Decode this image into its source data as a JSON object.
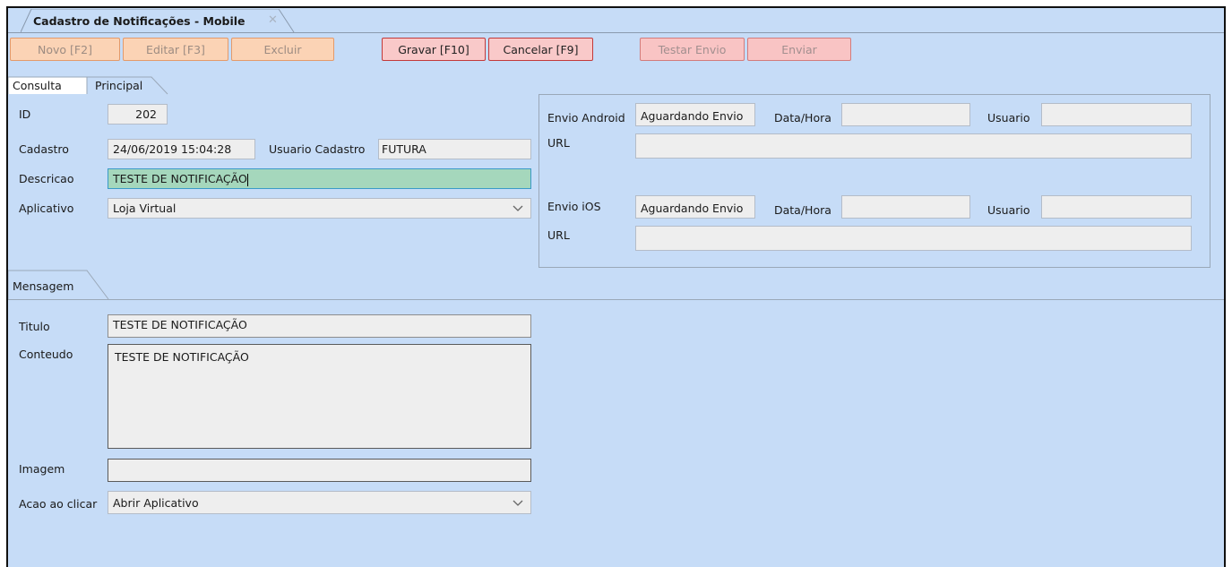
{
  "window": {
    "tab_title": "Cadastro de Notificações - Mobile",
    "close_glyph": "✕"
  },
  "toolbar": {
    "novo": "Novo [F2]",
    "editar": "Editar [F3]",
    "excluir": "Excluir",
    "gravar": "Gravar [F10]",
    "cancelar": "Cancelar [F9]",
    "testar_envio": "Testar Envio",
    "enviar": "Enviar"
  },
  "tabs": {
    "consulta": "Consulta",
    "principal": "Principal",
    "mensagem": "Mensagem"
  },
  "form": {
    "id_label": "ID",
    "id_value": "202",
    "cadastro_label": "Cadastro",
    "cadastro_value": "24/06/2019 15:04:28",
    "usuario_cadastro_label": "Usuario Cadastro",
    "usuario_cadastro_value": "FUTURA",
    "descricao_label": "Descricao",
    "descricao_value": "TESTE DE NOTIFICAÇÃO",
    "aplicativo_label": "Aplicativo",
    "aplicativo_value": "Loja Virtual"
  },
  "envio": {
    "android_label": "Envio Android",
    "android_status": "Aguardando Envio",
    "android_datahora_label": "Data/Hora",
    "android_datahora_value": "",
    "android_usuario_label": "Usuario",
    "android_usuario_value": "",
    "android_url_label": "URL",
    "android_url_value": "",
    "ios_label": "Envio iOS",
    "ios_status": "Aguardando Envio",
    "ios_datahora_label": "Data/Hora",
    "ios_datahora_value": "",
    "ios_usuario_label": "Usuario",
    "ios_usuario_value": "",
    "ios_url_label": "URL",
    "ios_url_value": ""
  },
  "mensagem": {
    "titulo_label": "Titulo",
    "titulo_value": "TESTE DE NOTIFICAÇÃO",
    "conteudo_label": "Conteudo",
    "conteudo_value": "TESTE DE NOTIFICAÇÃO",
    "imagem_label": "Imagem",
    "imagem_value": "",
    "acao_label": "Acao ao clicar",
    "acao_value": "Abrir Aplicativo"
  },
  "icons": {
    "dropdown": "chevron-down-icon",
    "close": "close-icon"
  },
  "colors": {
    "background": "#c6dcf7",
    "active_field": "#a5d7bc",
    "primary_button_border": "#c23a3a",
    "disabled_button_border": "#e49a6a"
  }
}
